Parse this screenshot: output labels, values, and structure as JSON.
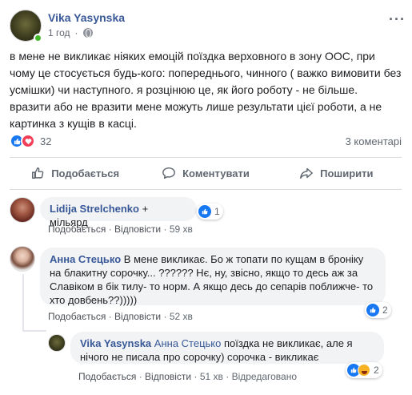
{
  "post": {
    "author": "Vika Yasynska",
    "time": "1 год",
    "text": "в мене не викликає ніяких емоцій поїздка верховного в зону ООС, при чому це стосується будь-кого: попереднього, чинного ( важко вимовити без усмішки) чи наступного. я розцінюю це, як його роботу - не більше. вразити або не вразити мене можуть лише результати цієї роботи, а не картинка з кущів в касці.",
    "reaction_count": "32",
    "comments_count": "3 коментарі"
  },
  "actions": {
    "like": "Подобається",
    "comment": "Коментувати",
    "share": "Поширити"
  },
  "comments": [
    {
      "author": "Lidija Strelchenko",
      "text": " + мільярд",
      "like": "Подобається",
      "reply": "Відповісти",
      "time": "59 хв",
      "reacts": "1"
    },
    {
      "author": "Анна Стецько",
      "text": " В мене викликає. Бо ж топати по кущам в броніку на блакитну сорочку... ?????? Нє, ну, звісно, якщо то десь аж за Славіком в бік тилу- то норм. А якщо десь до сепарів поближче- то хто довбень??)))))",
      "like": "Подобається",
      "reply": "Відповісти",
      "time": "52 хв",
      "reacts": "2"
    },
    {
      "author": "Vika Yasynska",
      "tag": " Анна Стецько",
      "text": " поїздка не викликає, але я нічого не писала про сорочку) сорочка - викликає",
      "like": "Подобається",
      "reply": "Відповісти",
      "time": "51 хв",
      "edited": "Відредаговано",
      "reacts": "2"
    }
  ],
  "separator": "·",
  "colors": {
    "link": "#385898",
    "muted": "#606770",
    "like_blue": "#1877f2",
    "love_red": "#f33e58",
    "online": "#42b72a"
  }
}
